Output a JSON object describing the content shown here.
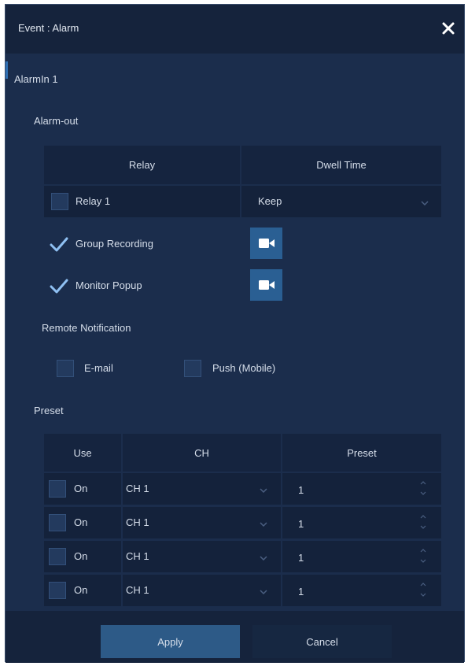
{
  "window": {
    "title": "Event : Alarm"
  },
  "section": "AlarmIn 1",
  "alarm_out": {
    "heading": "Alarm-out",
    "columns": [
      "Relay",
      "Dwell Time"
    ],
    "relay": {
      "label": "Relay 1",
      "checked": false
    },
    "dwell_value": "Keep"
  },
  "group_recording": {
    "label": "Group Recording",
    "checked": true
  },
  "monitor_popup": {
    "label": "Monitor Popup",
    "checked": true
  },
  "remote_notification": {
    "heading": "Remote Notification",
    "email": {
      "label": "E-mail",
      "checked": false
    },
    "push": {
      "label": "Push (Mobile)",
      "checked": false
    }
  },
  "preset": {
    "heading": "Preset",
    "columns": [
      "Use",
      "CH",
      "Preset"
    ],
    "rows": [
      {
        "use": "On",
        "ch": "CH 1",
        "preset": "1"
      },
      {
        "use": "On",
        "ch": "CH 1",
        "preset": "1"
      },
      {
        "use": "On",
        "ch": "CH 1",
        "preset": "1"
      },
      {
        "use": "On",
        "ch": "CH 1",
        "preset": "1"
      }
    ]
  },
  "footer": {
    "apply": "Apply",
    "cancel": "Cancel"
  },
  "colors": {
    "background": "#1b2d4c",
    "titlebar": "#15233c",
    "cell": "#14223b",
    "checkbox": "#233a5e",
    "check_mark": "#8fc0f2",
    "camera_button": "#2a5f93",
    "apply_button": "#2d5a87",
    "cancel_button": "#162741"
  }
}
